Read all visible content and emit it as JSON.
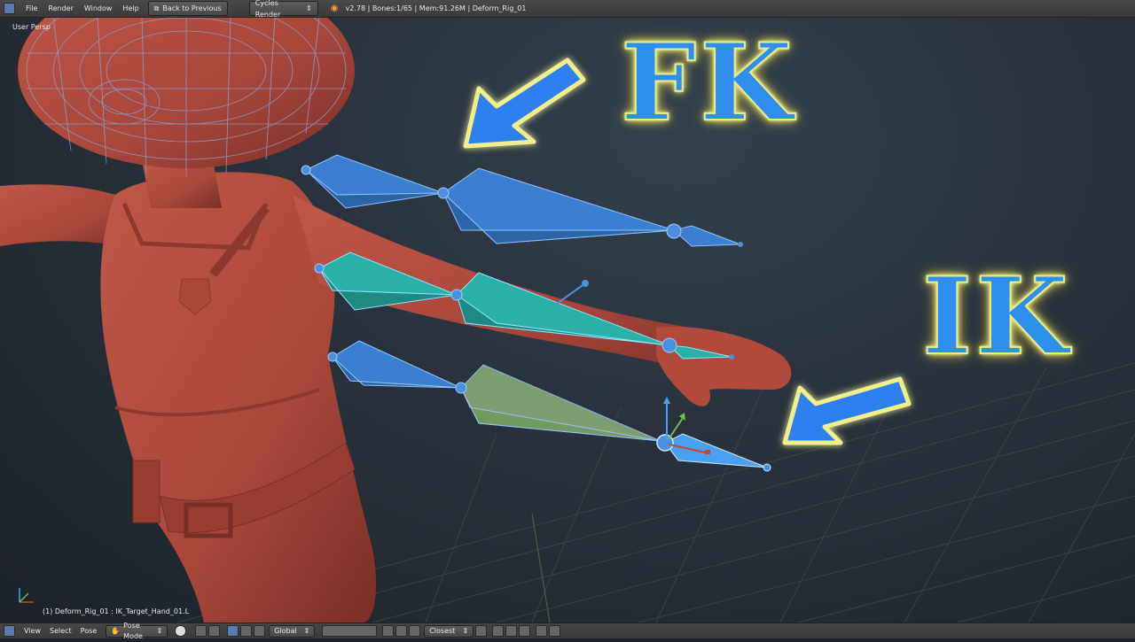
{
  "topbar": {
    "menu": [
      "File",
      "Render",
      "Window",
      "Help"
    ],
    "back_button": "Back to Previous",
    "render_engine": "Cycles Render",
    "info": "v2.78 | Bones:1/65  | Mem:91.26M | Deform_Rig_01"
  },
  "viewport": {
    "view_label": "User Persp",
    "status_label": "(1) Deform_Rig_01 : IK_Target_Hand_01.L",
    "annotation_fk": "FK",
    "annotation_ik": "IK"
  },
  "bottombar": {
    "menus": [
      "View",
      "Select",
      "Pose"
    ],
    "mode": "Pose Mode",
    "orientation": "Global",
    "snap": "Closest"
  },
  "colors": {
    "skin": "#b04a3a",
    "fk_bone": "#3a7fd0",
    "ik_bone": "#2bb0a8",
    "annotation": "#2e8ff0",
    "glow": "#f4f28a"
  }
}
